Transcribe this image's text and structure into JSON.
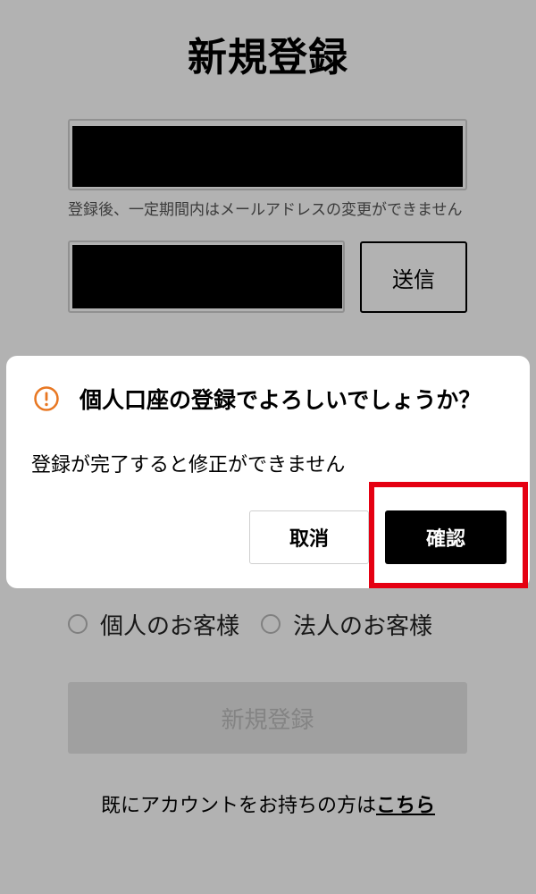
{
  "page": {
    "title": "新規登録",
    "email_hint": "登録後、一定期間内はメールアドレスの変更ができません",
    "send_label": "送信",
    "radio_options": [
      "個人のお客様",
      "法人のお客様"
    ],
    "register_label": "新規登録",
    "login_prompt": "既にアカウントをお持ちの方は",
    "login_link": "こちら"
  },
  "dialog": {
    "title": "個人口座の登録でよろしいでしょうか？",
    "message": "登録が完了すると修正ができません",
    "cancel_label": "取消",
    "confirm_label": "確認",
    "icon": "warning-circle-icon"
  },
  "colors": {
    "accent": "#e87722",
    "highlight": "#e50012",
    "primary_button": "#000000",
    "disabled_button": "#e6e6e6"
  }
}
